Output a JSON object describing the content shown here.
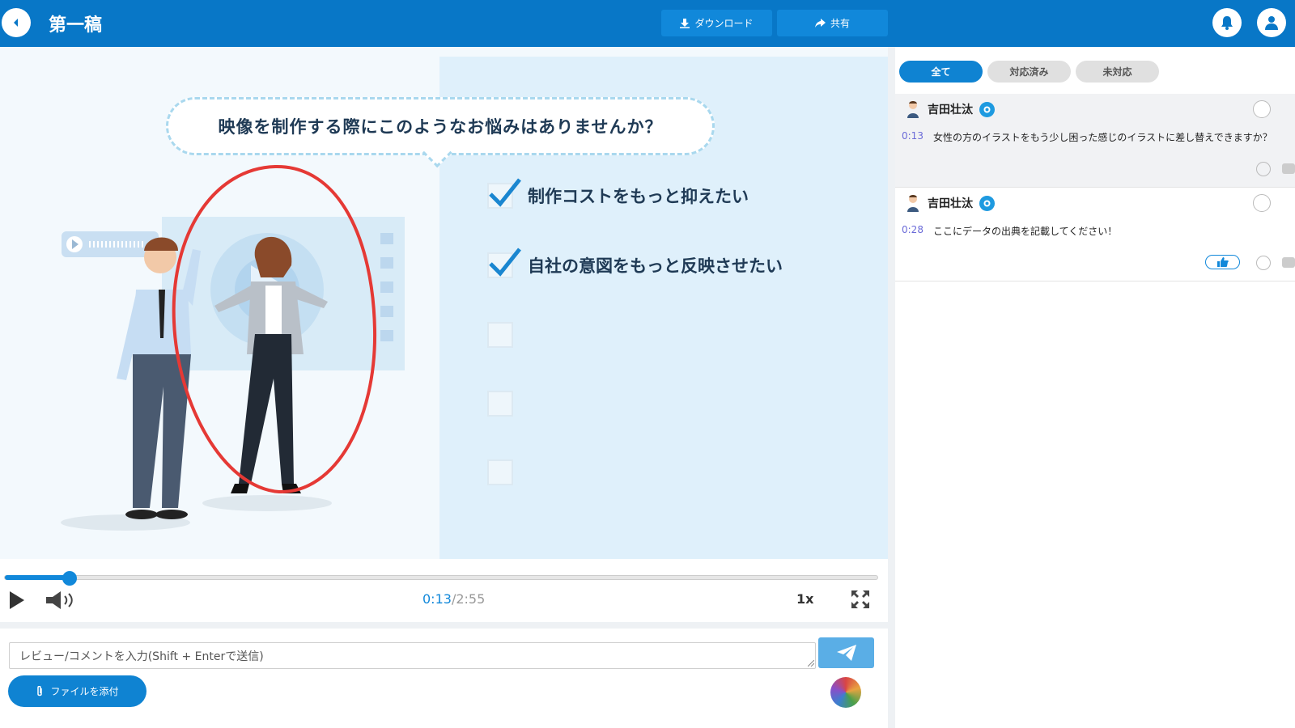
{
  "header": {
    "title": "第一稿",
    "download_label": "ダウンロード",
    "share_label": "共有"
  },
  "video": {
    "bubble_text": "映像を制作する際にこのようなお悩みはありませんか？",
    "checklist": [
      {
        "text": "制作コストをもっと抑えたい",
        "checked": true
      },
      {
        "text": "自社の意図をもっと反映させたい",
        "checked": true
      },
      {
        "text": "",
        "checked": false
      },
      {
        "text": "",
        "checked": false
      },
      {
        "text": "",
        "checked": false
      }
    ]
  },
  "player": {
    "current_time": "0:13",
    "separator": "/",
    "total_time": "2:55",
    "progress": 0.074,
    "speed": "1x"
  },
  "composer": {
    "placeholder": "レビュー/コメントを入力(Shift + Enterで送信)",
    "attach_label": "ファイルを添付"
  },
  "sidebar": {
    "tabs": [
      {
        "label": "全て",
        "active": true
      },
      {
        "label": "対応済み",
        "active": false
      },
      {
        "label": "未対応",
        "active": false
      }
    ],
    "comments": [
      {
        "user": "吉田壮汰",
        "timestamp": "0:13",
        "text": "女性の方のイラストをもう少し困った感じのイラストに差し替えできますか？",
        "liked": false
      },
      {
        "user": "吉田壮汰",
        "timestamp": "0:28",
        "text": "ここにデータの出典を記載してください！",
        "liked": true
      }
    ]
  },
  "colors": {
    "header": "#0877c7",
    "accent": "#1188da",
    "annotation": "#e53935"
  }
}
